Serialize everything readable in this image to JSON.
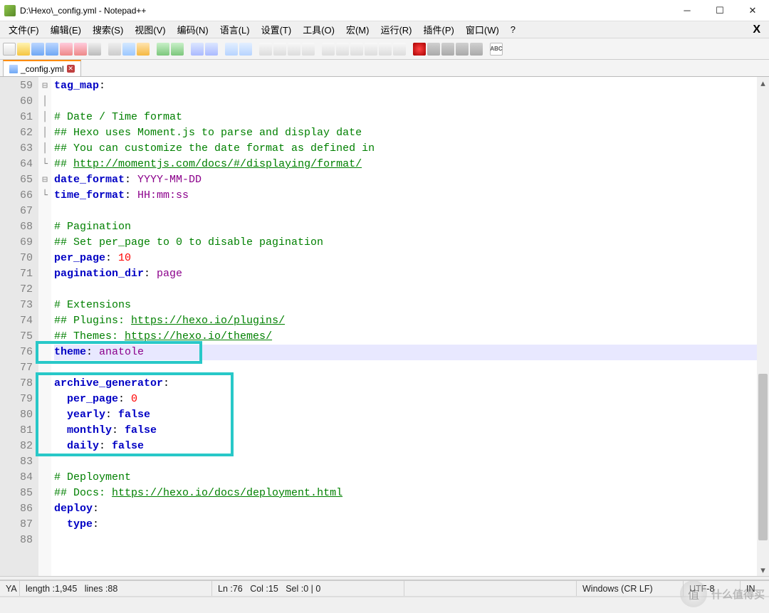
{
  "window": {
    "title": "D:\\Hexo\\_config.yml - Notepad++"
  },
  "menu": {
    "file": "文件(F)",
    "edit": "编辑(E)",
    "search": "搜索(S)",
    "view": "视图(V)",
    "encoding": "编码(N)",
    "language": "语言(L)",
    "settings": "设置(T)",
    "tools": "工具(O)",
    "macro": "宏(M)",
    "run": "运行(R)",
    "plugins": "插件(P)",
    "window": "窗口(W)",
    "help": "?",
    "x": "X"
  },
  "tab": {
    "label": "_config.yml"
  },
  "gutter_start": 59,
  "code": {
    "l59": {
      "k": "tag_map",
      "c": ":"
    },
    "l61": "# Date / Time format",
    "l62": "## Hexo uses Moment.js to parse and display date",
    "l63": "## You can customize the date format as defined in",
    "l64_pre": "## ",
    "l64_url": "http://momentjs.com/docs/#/displaying/format/",
    "l65": {
      "k": "date_format",
      "v": "YYYY-MM-DD"
    },
    "l66": {
      "k": "time_format",
      "v": "HH:mm:ss"
    },
    "l68": "# Pagination",
    "l69": "## Set per_page to 0 to disable pagination",
    "l70": {
      "k": "per_page",
      "n": "10"
    },
    "l71": {
      "k": "pagination_dir",
      "v": "page"
    },
    "l73": "# Extensions",
    "l74_pre": "## Plugins: ",
    "l74_url": "https://hexo.io/plugins/",
    "l75_pre": "## Themes: ",
    "l75_url": "https://hexo.io/themes/",
    "l76": {
      "k": "theme",
      "v": "anatole"
    },
    "l78": {
      "k": "archive_generator",
      "c": ":"
    },
    "l79": {
      "k": "per_page",
      "n": "0"
    },
    "l80": {
      "k": "yearly",
      "b": "false"
    },
    "l81": {
      "k": "monthly",
      "b": "false"
    },
    "l82": {
      "k": "daily",
      "b": "false"
    },
    "l84": "# Deployment",
    "l85_pre": "## Docs: ",
    "l85_url": "https://hexo.io/docs/deployment.html",
    "l86": {
      "k": "deploy",
      "c": ":"
    },
    "l87": {
      "k": "type",
      "c": ":"
    }
  },
  "status": {
    "filetype": "YA",
    "length_label": "length : ",
    "length": "1,945",
    "lines_label": "lines : ",
    "lines": "88",
    "ln_label": "Ln : ",
    "ln": "76",
    "col_label": "Col : ",
    "col": "15",
    "sel_label": "Sel : ",
    "sel": "0 | 0",
    "eol": "Windows (CR LF)",
    "encoding": "UTF-8",
    "ins": "IN"
  },
  "watermark": {
    "badge": "值",
    "text": "什么值得买"
  },
  "toolbar_spell": "ABC"
}
